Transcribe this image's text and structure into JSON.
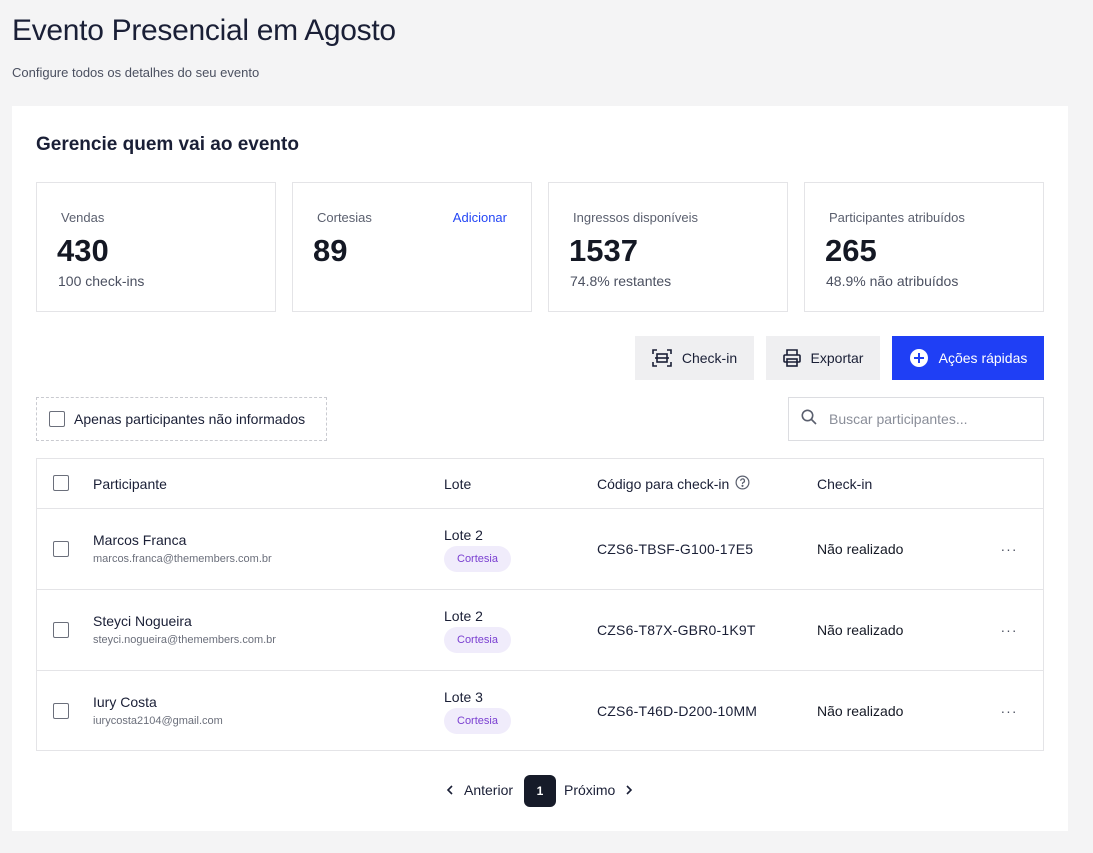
{
  "page": {
    "title": "Evento Presencial em Agosto",
    "subtitle": "Configure todos os detalhes do seu evento"
  },
  "section": {
    "title": "Gerencie quem vai ao evento"
  },
  "stats": [
    {
      "label": "Vendas",
      "value": "430",
      "sub": "100 check-ins"
    },
    {
      "label": "Cortesias",
      "value": "89",
      "link": "Adicionar"
    },
    {
      "label": "Ingressos disponíveis",
      "value": "1537",
      "sub": "74.8% restantes"
    },
    {
      "label": "Participantes atribuídos",
      "value": "265",
      "sub": "48.9% não atribuídos"
    }
  ],
  "actions": {
    "checkin": "Check-in",
    "export": "Exportar",
    "quick": "Ações rápidas"
  },
  "filter": {
    "label": "Apenas participantes não informados",
    "checked": false
  },
  "search": {
    "placeholder": "Buscar participantes...",
    "value": ""
  },
  "table": {
    "columns": {
      "participant": "Participante",
      "lote": "Lote",
      "code": "Código para check-in",
      "checkin": "Check-in"
    },
    "rows": [
      {
        "name": "Marcos Franca",
        "email": "marcos.franca@themembers.com.br",
        "lote": "Lote 2",
        "badge": "Cortesia",
        "code": "CZS6-TBSF-G100-17E5",
        "status": "Não realizado"
      },
      {
        "name": "Steyci Nogueira",
        "email": "steyci.nogueira@themembers.com.br",
        "lote": "Lote 2",
        "badge": "Cortesia",
        "code": "CZS6-T87X-GBR0-1K9T",
        "status": "Não realizado"
      },
      {
        "name": "Iury Costa",
        "email": "iurycosta2104@gmail.com",
        "lote": "Lote 3",
        "badge": "Cortesia",
        "code": "CZS6-T46D-D200-10MM",
        "status": "Não realizado"
      }
    ],
    "more_glyph": "···"
  },
  "pagination": {
    "prev": "Anterior",
    "next": "Próximo",
    "current": "1"
  },
  "colors": {
    "primary": "#1f3ff5",
    "link": "#2446f5",
    "badge_bg": "#f0ecfb",
    "badge_text": "#7a3fd1",
    "page_bg": "#f4f4f5"
  },
  "icons": {
    "checkin": "scan-icon",
    "export": "printer-icon",
    "quick": "plus-circle-icon",
    "search": "search-icon",
    "help": "help-circle-icon",
    "more": "more-horizontal-icon",
    "prev": "chevron-left-icon",
    "next": "chevron-right-icon"
  }
}
